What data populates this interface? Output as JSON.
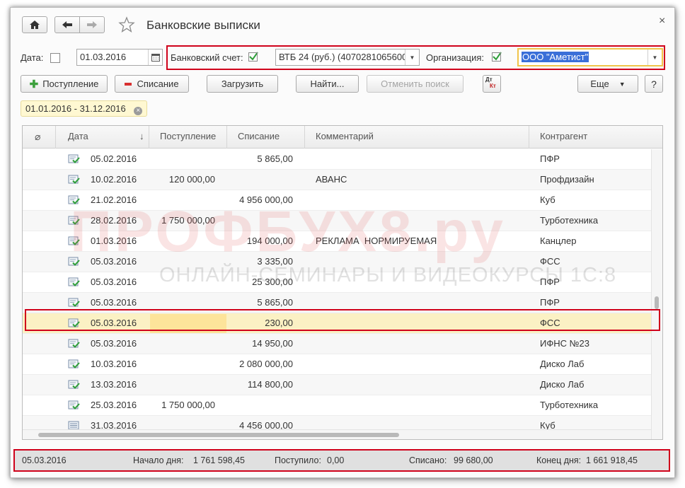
{
  "header": {
    "title": "Банковские выписки",
    "close_glyph": "×"
  },
  "filters": {
    "date_label": "Дата:",
    "date_value": "01.03.2016",
    "bank_account_label": "Банковский счет:",
    "bank_account_value": "ВТБ 24 (руб.) (4070281065600",
    "organization_label": "Организация:",
    "organization_value": "ООО \"Аметист\""
  },
  "toolbar": {
    "receipt_label": "Поступление",
    "writeoff_label": "Списание",
    "load_label": "Загрузить",
    "find_label": "Найти...",
    "cancel_search_label": "Отменить поиск",
    "dtkt_top": "Дт",
    "dtkt_bottom": "Кт",
    "more_label": "Еще",
    "help_label": "?"
  },
  "period_chip": "01.01.2016 - 31.12.2016",
  "table": {
    "columns": {
      "attach": "",
      "date": "Дата",
      "sort": "↓",
      "receipt": "Поступление",
      "writeoff": "Списание",
      "comment": "Комментарий",
      "counterparty": "Контрагент"
    },
    "rows": [
      {
        "date": "05.02.2016",
        "receipt": "",
        "writeoff": "5 865,00",
        "comment": "",
        "counterparty": "ПФР"
      },
      {
        "date": "10.02.2016",
        "receipt": "120 000,00",
        "writeoff": "",
        "comment": "АВАНС",
        "counterparty": "Профдизайн"
      },
      {
        "date": "21.02.2016",
        "receipt": "",
        "writeoff": "4 956 000,00",
        "comment": "",
        "counterparty": "Куб"
      },
      {
        "date": "28.02.2016",
        "receipt": "1 750 000,00",
        "writeoff": "",
        "comment": "",
        "counterparty": "Турботехника"
      },
      {
        "date": "01.03.2016",
        "receipt": "",
        "writeoff": "194 000,00",
        "comment": "РЕКЛАМА  НОРМИРУЕМАЯ",
        "counterparty": "Канцлер"
      },
      {
        "date": "05.03.2016",
        "receipt": "",
        "writeoff": "3 335,00",
        "comment": "",
        "counterparty": "ФСС"
      },
      {
        "date": "05.03.2016",
        "receipt": "",
        "writeoff": "25 300,00",
        "comment": "",
        "counterparty": "ПФР"
      },
      {
        "date": "05.03.2016",
        "receipt": "",
        "writeoff": "5 865,00",
        "comment": "",
        "counterparty": "ПФР"
      },
      {
        "date": "05.03.2016",
        "receipt": "",
        "writeoff": "230,00",
        "comment": "",
        "counterparty": "ФСС"
      },
      {
        "date": "05.03.2016",
        "receipt": "",
        "writeoff": "14 950,00",
        "comment": "",
        "counterparty": "ИФНС №23"
      },
      {
        "date": "10.03.2016",
        "receipt": "",
        "writeoff": "2 080 000,00",
        "comment": "",
        "counterparty": "Диско Лаб"
      },
      {
        "date": "13.03.2016",
        "receipt": "",
        "writeoff": "114 800,00",
        "comment": "",
        "counterparty": "Диско Лаб"
      },
      {
        "date": "25.03.2016",
        "receipt": "1 750 000,00",
        "writeoff": "",
        "comment": "",
        "counterparty": "Турботехника"
      },
      {
        "date": "31.03.2016",
        "receipt": "",
        "writeoff": "4 456 000,00",
        "comment": "",
        "counterparty": "Куб"
      }
    ]
  },
  "status": {
    "date": "05.03.2016",
    "start_label": "Начало дня:",
    "start_value": "1 761 598,45",
    "received_label": "Поступило:",
    "received_value": "0,00",
    "spent_label": "Списано:",
    "spent_value": "99 680,00",
    "end_label": "Конец дня:",
    "end_value": "1 661 918,45"
  },
  "watermark": {
    "main": "ПРОФБУХ8.ру",
    "sub": "ОНЛАЙН-СЕМИНАРЫ И ВИДЕОКУРСЫ 1С:8"
  },
  "colors": {
    "highlight_border": "#d0021b",
    "selected_row": "#fbf1c4",
    "check_green": "#2f9e3a",
    "org_selection": "#3a6fd8"
  }
}
